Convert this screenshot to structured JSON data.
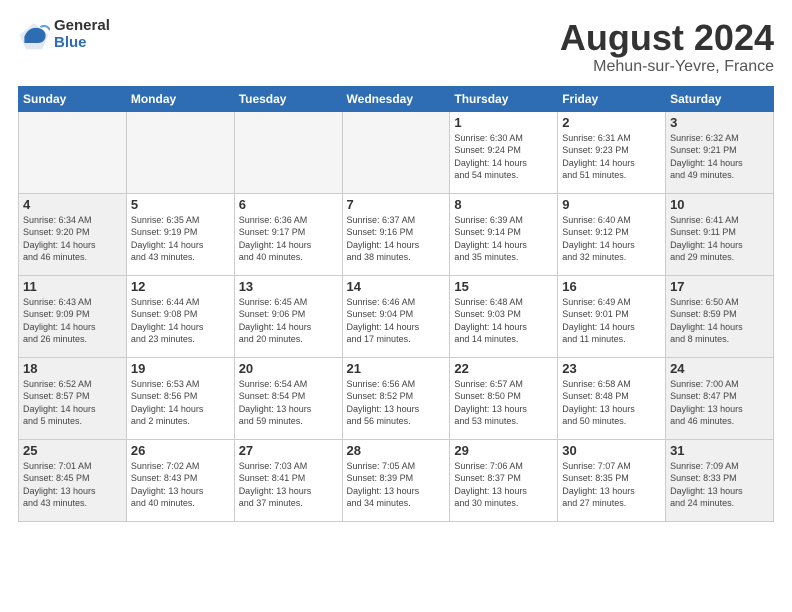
{
  "logo": {
    "general": "General",
    "blue": "Blue"
  },
  "title": "August 2024",
  "location": "Mehun-sur-Yevre, France",
  "days_of_week": [
    "Sunday",
    "Monday",
    "Tuesday",
    "Wednesday",
    "Thursday",
    "Friday",
    "Saturday"
  ],
  "weeks": [
    [
      {
        "day": "",
        "info": "",
        "empty": true
      },
      {
        "day": "",
        "info": "",
        "empty": true
      },
      {
        "day": "",
        "info": "",
        "empty": true
      },
      {
        "day": "",
        "info": "",
        "empty": true
      },
      {
        "day": "1",
        "info": "Sunrise: 6:30 AM\nSunset: 9:24 PM\nDaylight: 14 hours\nand 54 minutes."
      },
      {
        "day": "2",
        "info": "Sunrise: 6:31 AM\nSunset: 9:23 PM\nDaylight: 14 hours\nand 51 minutes."
      },
      {
        "day": "3",
        "info": "Sunrise: 6:32 AM\nSunset: 9:21 PM\nDaylight: 14 hours\nand 49 minutes."
      }
    ],
    [
      {
        "day": "4",
        "info": "Sunrise: 6:34 AM\nSunset: 9:20 PM\nDaylight: 14 hours\nand 46 minutes."
      },
      {
        "day": "5",
        "info": "Sunrise: 6:35 AM\nSunset: 9:19 PM\nDaylight: 14 hours\nand 43 minutes."
      },
      {
        "day": "6",
        "info": "Sunrise: 6:36 AM\nSunset: 9:17 PM\nDaylight: 14 hours\nand 40 minutes."
      },
      {
        "day": "7",
        "info": "Sunrise: 6:37 AM\nSunset: 9:16 PM\nDaylight: 14 hours\nand 38 minutes."
      },
      {
        "day": "8",
        "info": "Sunrise: 6:39 AM\nSunset: 9:14 PM\nDaylight: 14 hours\nand 35 minutes."
      },
      {
        "day": "9",
        "info": "Sunrise: 6:40 AM\nSunset: 9:12 PM\nDaylight: 14 hours\nand 32 minutes."
      },
      {
        "day": "10",
        "info": "Sunrise: 6:41 AM\nSunset: 9:11 PM\nDaylight: 14 hours\nand 29 minutes."
      }
    ],
    [
      {
        "day": "11",
        "info": "Sunrise: 6:43 AM\nSunset: 9:09 PM\nDaylight: 14 hours\nand 26 minutes."
      },
      {
        "day": "12",
        "info": "Sunrise: 6:44 AM\nSunset: 9:08 PM\nDaylight: 14 hours\nand 23 minutes."
      },
      {
        "day": "13",
        "info": "Sunrise: 6:45 AM\nSunset: 9:06 PM\nDaylight: 14 hours\nand 20 minutes."
      },
      {
        "day": "14",
        "info": "Sunrise: 6:46 AM\nSunset: 9:04 PM\nDaylight: 14 hours\nand 17 minutes."
      },
      {
        "day": "15",
        "info": "Sunrise: 6:48 AM\nSunset: 9:03 PM\nDaylight: 14 hours\nand 14 minutes."
      },
      {
        "day": "16",
        "info": "Sunrise: 6:49 AM\nSunset: 9:01 PM\nDaylight: 14 hours\nand 11 minutes."
      },
      {
        "day": "17",
        "info": "Sunrise: 6:50 AM\nSunset: 8:59 PM\nDaylight: 14 hours\nand 8 minutes."
      }
    ],
    [
      {
        "day": "18",
        "info": "Sunrise: 6:52 AM\nSunset: 8:57 PM\nDaylight: 14 hours\nand 5 minutes."
      },
      {
        "day": "19",
        "info": "Sunrise: 6:53 AM\nSunset: 8:56 PM\nDaylight: 14 hours\nand 2 minutes."
      },
      {
        "day": "20",
        "info": "Sunrise: 6:54 AM\nSunset: 8:54 PM\nDaylight: 13 hours\nand 59 minutes."
      },
      {
        "day": "21",
        "info": "Sunrise: 6:56 AM\nSunset: 8:52 PM\nDaylight: 13 hours\nand 56 minutes."
      },
      {
        "day": "22",
        "info": "Sunrise: 6:57 AM\nSunset: 8:50 PM\nDaylight: 13 hours\nand 53 minutes."
      },
      {
        "day": "23",
        "info": "Sunrise: 6:58 AM\nSunset: 8:48 PM\nDaylight: 13 hours\nand 50 minutes."
      },
      {
        "day": "24",
        "info": "Sunrise: 7:00 AM\nSunset: 8:47 PM\nDaylight: 13 hours\nand 46 minutes."
      }
    ],
    [
      {
        "day": "25",
        "info": "Sunrise: 7:01 AM\nSunset: 8:45 PM\nDaylight: 13 hours\nand 43 minutes."
      },
      {
        "day": "26",
        "info": "Sunrise: 7:02 AM\nSunset: 8:43 PM\nDaylight: 13 hours\nand 40 minutes."
      },
      {
        "day": "27",
        "info": "Sunrise: 7:03 AM\nSunset: 8:41 PM\nDaylight: 13 hours\nand 37 minutes."
      },
      {
        "day": "28",
        "info": "Sunrise: 7:05 AM\nSunset: 8:39 PM\nDaylight: 13 hours\nand 34 minutes."
      },
      {
        "day": "29",
        "info": "Sunrise: 7:06 AM\nSunset: 8:37 PM\nDaylight: 13 hours\nand 30 minutes."
      },
      {
        "day": "30",
        "info": "Sunrise: 7:07 AM\nSunset: 8:35 PM\nDaylight: 13 hours\nand 27 minutes."
      },
      {
        "day": "31",
        "info": "Sunrise: 7:09 AM\nSunset: 8:33 PM\nDaylight: 13 hours\nand 24 minutes."
      }
    ]
  ]
}
